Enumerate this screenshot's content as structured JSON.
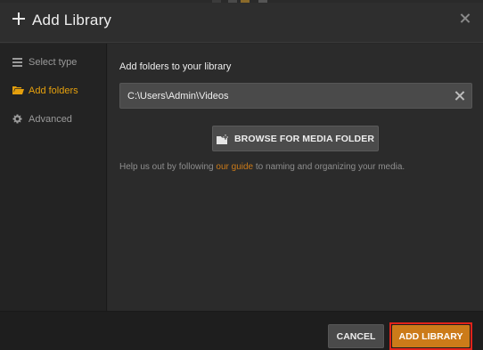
{
  "dialog": {
    "title": "Add Library",
    "close_icon": "close-icon"
  },
  "sidebar": {
    "items": [
      {
        "label": "Select type",
        "icon": "list-icon",
        "active": false
      },
      {
        "label": "Add folders",
        "icon": "folder-icon",
        "active": true
      },
      {
        "label": "Advanced",
        "icon": "gear-icon",
        "active": false
      }
    ]
  },
  "main": {
    "section_label": "Add folders to your library",
    "folder_path": "C:\\Users\\Admin\\Videos",
    "browse_label": "BROWSE FOR MEDIA FOLDER",
    "help_prefix": "Help us out by following ",
    "help_link": "our guide",
    "help_suffix": " to naming and organizing your media."
  },
  "footer": {
    "cancel_label": "CANCEL",
    "add_label": "ADD LIBRARY"
  },
  "colors": {
    "accent": "#cc7b19",
    "active_nav": "#e5a00d",
    "highlight_border": "#e1231a"
  }
}
